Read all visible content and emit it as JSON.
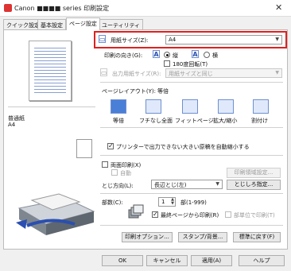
{
  "window": {
    "title": "Canon ■■■■ series 印刷設定"
  },
  "tabs": [
    {
      "label": "クイック設定"
    },
    {
      "label": "基本設定"
    },
    {
      "label": "ページ設定"
    },
    {
      "label": "ユーティリティ"
    }
  ],
  "left": {
    "paper_line1": "普通紙",
    "paper_line2": "A4"
  },
  "paper_size": {
    "label": "用紙サイズ(Z):",
    "value": "A4"
  },
  "orientation": {
    "label": "印刷の向き(G):",
    "portrait": "縦",
    "landscape": "横",
    "rotate180": "180度回転(T)"
  },
  "output_size": {
    "label": "出力用紙サイズ(R):",
    "value": "用紙サイズと同じ"
  },
  "page_layout": {
    "label": "ページレイアウト(Y):",
    "current": "等倍",
    "options": [
      "等倍",
      "フチなし全面",
      "フィットページ",
      "拡大/縮小",
      "割付け"
    ]
  },
  "shrink_option": "プリンターで出力できない大きい原稿を自動縮小する",
  "duplex": {
    "label": "両面印刷(X)",
    "auto": "自動",
    "settings_button": "印刷領域設定..."
  },
  "binding": {
    "label": "とじ方向(L):",
    "value": "長辺とじ(左)",
    "margin_button": "とじしろ指定..."
  },
  "copies": {
    "label": "部数(C):",
    "value": "1",
    "range": "部(1-999)",
    "last_page_first": "最終ページから印刷(R)",
    "collate": "部単位で印刷(T)"
  },
  "actions": {
    "print_options": "印刷オプション...",
    "stamp_background": "スタンプ/背景...",
    "restore_defaults": "標準に戻す(F)"
  },
  "dialog_buttons": {
    "ok": "OK",
    "cancel": "キャンセル",
    "apply": "適用(A)",
    "help": "ヘルプ"
  },
  "colors": {
    "highlight": "#e02020",
    "accent": "#4a7fd8"
  }
}
